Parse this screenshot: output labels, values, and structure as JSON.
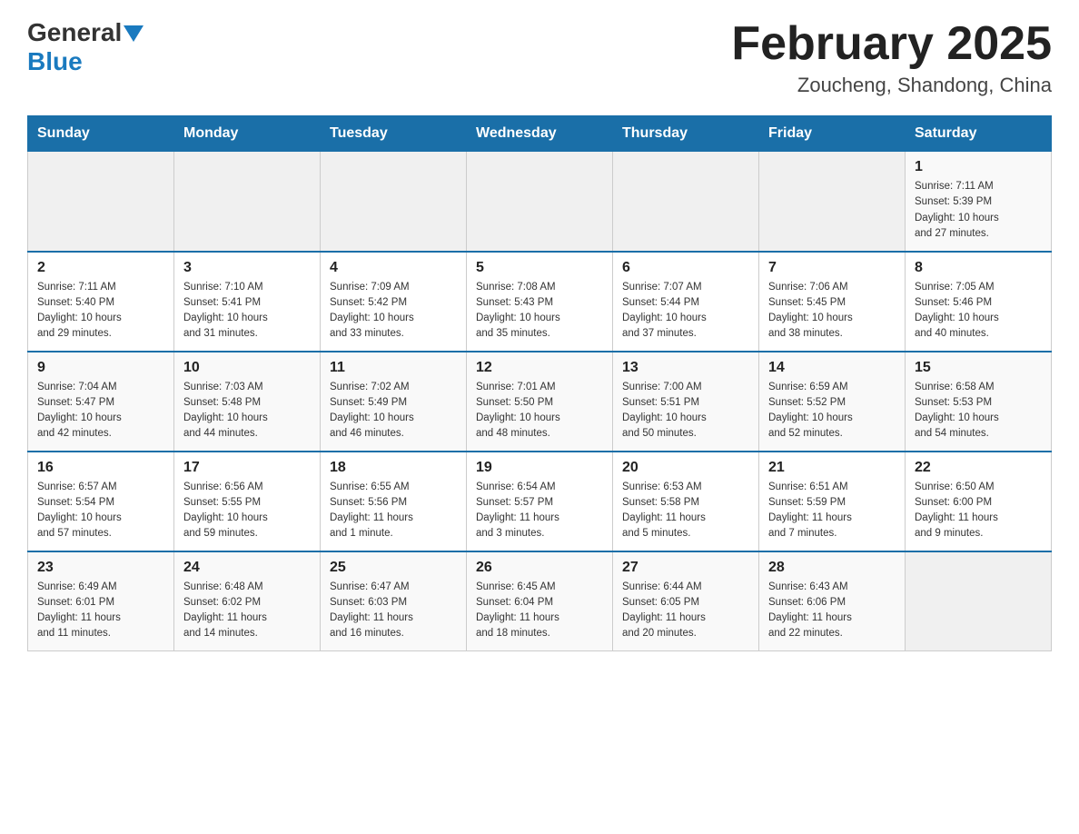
{
  "logo": {
    "general": "General",
    "blue": "Blue"
  },
  "title": "February 2025",
  "location": "Zoucheng, Shandong, China",
  "weekdays": [
    "Sunday",
    "Monday",
    "Tuesday",
    "Wednesday",
    "Thursday",
    "Friday",
    "Saturday"
  ],
  "rows": [
    [
      {
        "day": "",
        "info": ""
      },
      {
        "day": "",
        "info": ""
      },
      {
        "day": "",
        "info": ""
      },
      {
        "day": "",
        "info": ""
      },
      {
        "day": "",
        "info": ""
      },
      {
        "day": "",
        "info": ""
      },
      {
        "day": "1",
        "info": "Sunrise: 7:11 AM\nSunset: 5:39 PM\nDaylight: 10 hours\nand 27 minutes."
      }
    ],
    [
      {
        "day": "2",
        "info": "Sunrise: 7:11 AM\nSunset: 5:40 PM\nDaylight: 10 hours\nand 29 minutes."
      },
      {
        "day": "3",
        "info": "Sunrise: 7:10 AM\nSunset: 5:41 PM\nDaylight: 10 hours\nand 31 minutes."
      },
      {
        "day": "4",
        "info": "Sunrise: 7:09 AM\nSunset: 5:42 PM\nDaylight: 10 hours\nand 33 minutes."
      },
      {
        "day": "5",
        "info": "Sunrise: 7:08 AM\nSunset: 5:43 PM\nDaylight: 10 hours\nand 35 minutes."
      },
      {
        "day": "6",
        "info": "Sunrise: 7:07 AM\nSunset: 5:44 PM\nDaylight: 10 hours\nand 37 minutes."
      },
      {
        "day": "7",
        "info": "Sunrise: 7:06 AM\nSunset: 5:45 PM\nDaylight: 10 hours\nand 38 minutes."
      },
      {
        "day": "8",
        "info": "Sunrise: 7:05 AM\nSunset: 5:46 PM\nDaylight: 10 hours\nand 40 minutes."
      }
    ],
    [
      {
        "day": "9",
        "info": "Sunrise: 7:04 AM\nSunset: 5:47 PM\nDaylight: 10 hours\nand 42 minutes."
      },
      {
        "day": "10",
        "info": "Sunrise: 7:03 AM\nSunset: 5:48 PM\nDaylight: 10 hours\nand 44 minutes."
      },
      {
        "day": "11",
        "info": "Sunrise: 7:02 AM\nSunset: 5:49 PM\nDaylight: 10 hours\nand 46 minutes."
      },
      {
        "day": "12",
        "info": "Sunrise: 7:01 AM\nSunset: 5:50 PM\nDaylight: 10 hours\nand 48 minutes."
      },
      {
        "day": "13",
        "info": "Sunrise: 7:00 AM\nSunset: 5:51 PM\nDaylight: 10 hours\nand 50 minutes."
      },
      {
        "day": "14",
        "info": "Sunrise: 6:59 AM\nSunset: 5:52 PM\nDaylight: 10 hours\nand 52 minutes."
      },
      {
        "day": "15",
        "info": "Sunrise: 6:58 AM\nSunset: 5:53 PM\nDaylight: 10 hours\nand 54 minutes."
      }
    ],
    [
      {
        "day": "16",
        "info": "Sunrise: 6:57 AM\nSunset: 5:54 PM\nDaylight: 10 hours\nand 57 minutes."
      },
      {
        "day": "17",
        "info": "Sunrise: 6:56 AM\nSunset: 5:55 PM\nDaylight: 10 hours\nand 59 minutes."
      },
      {
        "day": "18",
        "info": "Sunrise: 6:55 AM\nSunset: 5:56 PM\nDaylight: 11 hours\nand 1 minute."
      },
      {
        "day": "19",
        "info": "Sunrise: 6:54 AM\nSunset: 5:57 PM\nDaylight: 11 hours\nand 3 minutes."
      },
      {
        "day": "20",
        "info": "Sunrise: 6:53 AM\nSunset: 5:58 PM\nDaylight: 11 hours\nand 5 minutes."
      },
      {
        "day": "21",
        "info": "Sunrise: 6:51 AM\nSunset: 5:59 PM\nDaylight: 11 hours\nand 7 minutes."
      },
      {
        "day": "22",
        "info": "Sunrise: 6:50 AM\nSunset: 6:00 PM\nDaylight: 11 hours\nand 9 minutes."
      }
    ],
    [
      {
        "day": "23",
        "info": "Sunrise: 6:49 AM\nSunset: 6:01 PM\nDaylight: 11 hours\nand 11 minutes."
      },
      {
        "day": "24",
        "info": "Sunrise: 6:48 AM\nSunset: 6:02 PM\nDaylight: 11 hours\nand 14 minutes."
      },
      {
        "day": "25",
        "info": "Sunrise: 6:47 AM\nSunset: 6:03 PM\nDaylight: 11 hours\nand 16 minutes."
      },
      {
        "day": "26",
        "info": "Sunrise: 6:45 AM\nSunset: 6:04 PM\nDaylight: 11 hours\nand 18 minutes."
      },
      {
        "day": "27",
        "info": "Sunrise: 6:44 AM\nSunset: 6:05 PM\nDaylight: 11 hours\nand 20 minutes."
      },
      {
        "day": "28",
        "info": "Sunrise: 6:43 AM\nSunset: 6:06 PM\nDaylight: 11 hours\nand 22 minutes."
      },
      {
        "day": "",
        "info": ""
      }
    ]
  ]
}
